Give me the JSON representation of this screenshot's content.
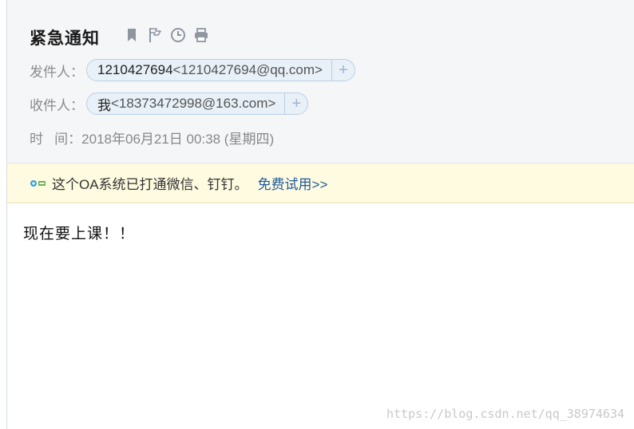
{
  "mail": {
    "subject": "紧急通知",
    "from": {
      "label": "发件人：",
      "name": "1210427694",
      "address": "<1210427694@qq.com>",
      "add_label": "+"
    },
    "to": {
      "label": "收件人：",
      "name": "我",
      "address": "<18373472998@163.com>",
      "add_label": "+"
    },
    "time": {
      "label": "时   间：",
      "value": "2018年06月21日 00:38 (星期四)"
    },
    "body": "现在要上课！！"
  },
  "toolbar": {
    "icons": [
      "bookmark-icon",
      "flag-icon",
      "clock-icon",
      "print-icon"
    ]
  },
  "banner": {
    "icon": "oa-app-icon",
    "text": "这个OA系统已打通微信、钉钉。",
    "link": "免费试用>>"
  },
  "watermark": "https://blog.csdn.net/qq_38974634",
  "colors": {
    "header_bg": "#f5f6f8",
    "banner_bg": "#fffbe0",
    "chip_bg": "#e8f0f8",
    "link": "#1d5a9e"
  }
}
